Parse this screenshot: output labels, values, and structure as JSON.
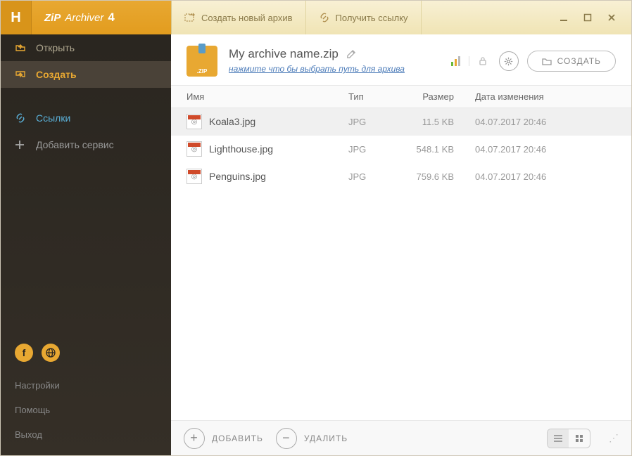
{
  "app": {
    "logo_zip": "ZiP",
    "logo_archiver": "Archiver",
    "version": "4"
  },
  "toolbar": {
    "create_new": "Создать новый архив",
    "get_link": "Получить ссылку"
  },
  "sidebar": {
    "open": "Открыть",
    "create": "Создать",
    "links": "Ссылки",
    "add_service": "Добавить сервис",
    "settings": "Настройки",
    "help": "Помощь",
    "exit": "Выход"
  },
  "archive": {
    "name": "My archive name.zip",
    "path_hint": "нажмите что бы выбрать путь для архива",
    "create_btn": "СОЗДАТЬ"
  },
  "columns": {
    "name": "Имя",
    "type": "Тип",
    "size": "Размер",
    "date": "Дата изменения"
  },
  "files": [
    {
      "name": "Koala3.jpg",
      "type": "JPG",
      "size": "11.5 KB",
      "date": "04.07.2017 20:46",
      "selected": true
    },
    {
      "name": "Lighthouse.jpg",
      "type": "JPG",
      "size": "548.1 KB",
      "date": "04.07.2017 20:46",
      "selected": false
    },
    {
      "name": "Penguins.jpg",
      "type": "JPG",
      "size": "759.6 KB",
      "date": "04.07.2017 20:46",
      "selected": false
    }
  ],
  "bottom": {
    "add": "ДОБАВИТЬ",
    "remove": "УДАЛИТЬ"
  }
}
